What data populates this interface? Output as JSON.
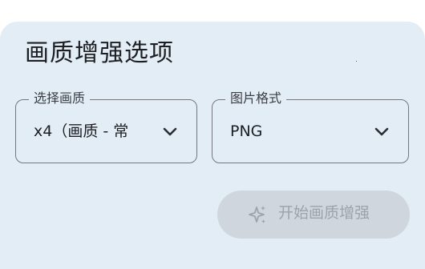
{
  "dialog": {
    "title": "画质增强选项"
  },
  "quality_select": {
    "label": "选择画质",
    "value": "x4（画质 - 常"
  },
  "format_select": {
    "label": "图片格式",
    "value": "PNG"
  },
  "enhance_button": {
    "label": "开始画质增强",
    "icon": "sparkle-icon",
    "state": "disabled"
  },
  "colors": {
    "surface": "#e3edf6",
    "outline": "#74777c",
    "disabled_button": "#cfd6dd",
    "disabled_text": "#9ca3aa"
  }
}
